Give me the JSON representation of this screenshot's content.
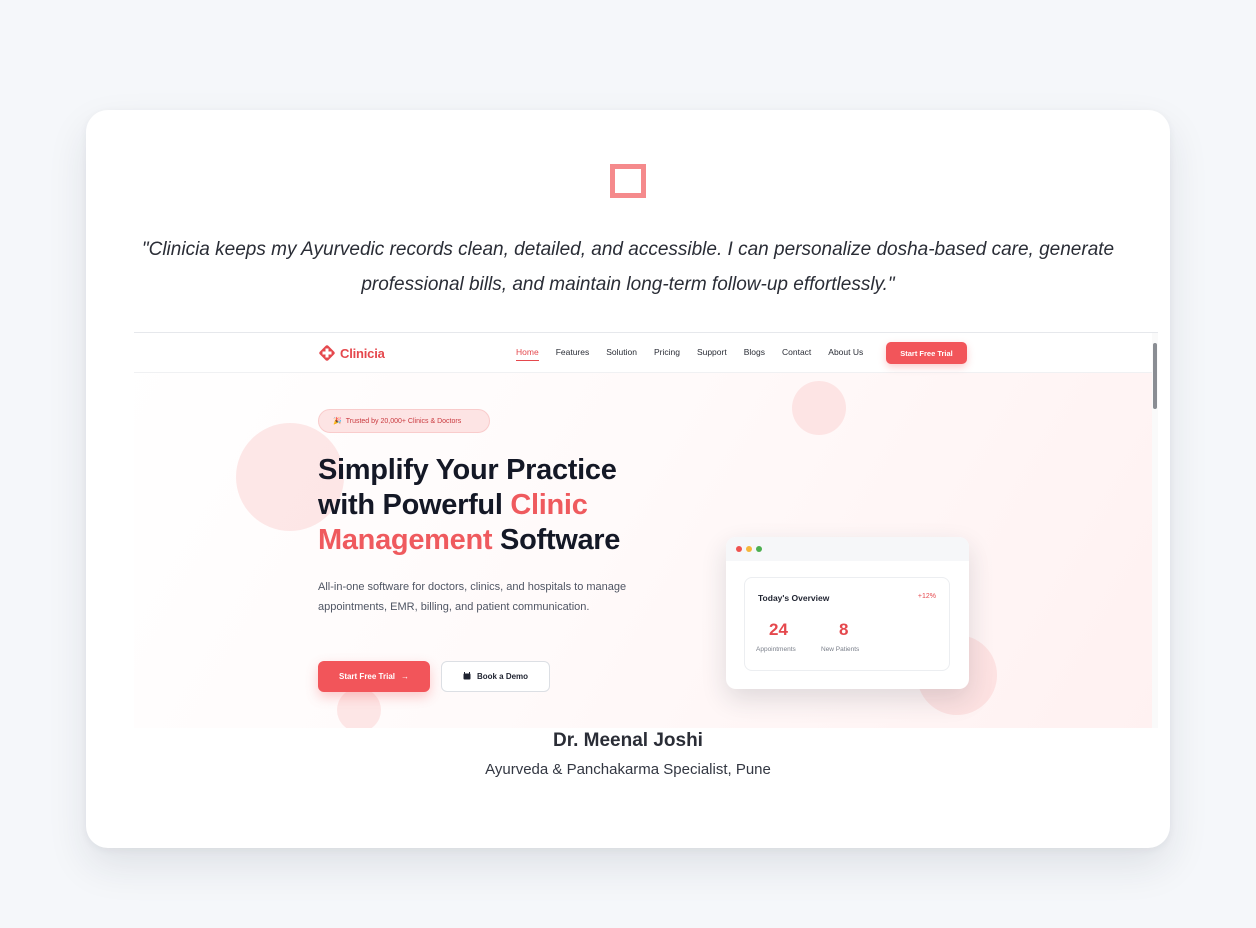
{
  "testimonial": {
    "quote": "\"Clinicia keeps my Ayurvedic records clean, detailed, and accessible. I can personalize dosha-based care, generate professional bills, and maintain long-term follow-up effortlessly.\"",
    "author_name": "Dr. Meenal Joshi",
    "author_role": "Ayurveda & Panchakarma Specialist, Pune",
    "quote_icon": "quote-icon"
  },
  "screenshot": {
    "brand": "Clinicia",
    "nav": [
      "Home",
      "Features",
      "Solution",
      "Pricing",
      "Support",
      "Blogs",
      "Contact",
      "About Us"
    ],
    "nav_active": "Home",
    "nav_cta": "Start Free Trial",
    "badge": "Trusted by 20,000+ Clinics & Doctors",
    "hero_line1": "Simplify Your Practice",
    "hero_line2a": "with Powerful ",
    "hero_line2b": "Clinic",
    "hero_line3a": "Management",
    "hero_line3b": " Software",
    "hero_sub": "All-in-one software for doctors, clinics, and hospitals to manage appointments, EMR, billing, and patient communication.",
    "btn_primary": "Start Free Trial",
    "btn_secondary": "Book a Demo",
    "overview": {
      "title": "Today's Overview",
      "change": "+12%",
      "appointments_value": "24",
      "appointments_label": "Appointments",
      "patients_value": "8",
      "patients_label": "New Patients"
    }
  },
  "colors": {
    "accent": "#f2555a",
    "quote_icon": "#f58a8c",
    "background": "#f5f7fa"
  }
}
